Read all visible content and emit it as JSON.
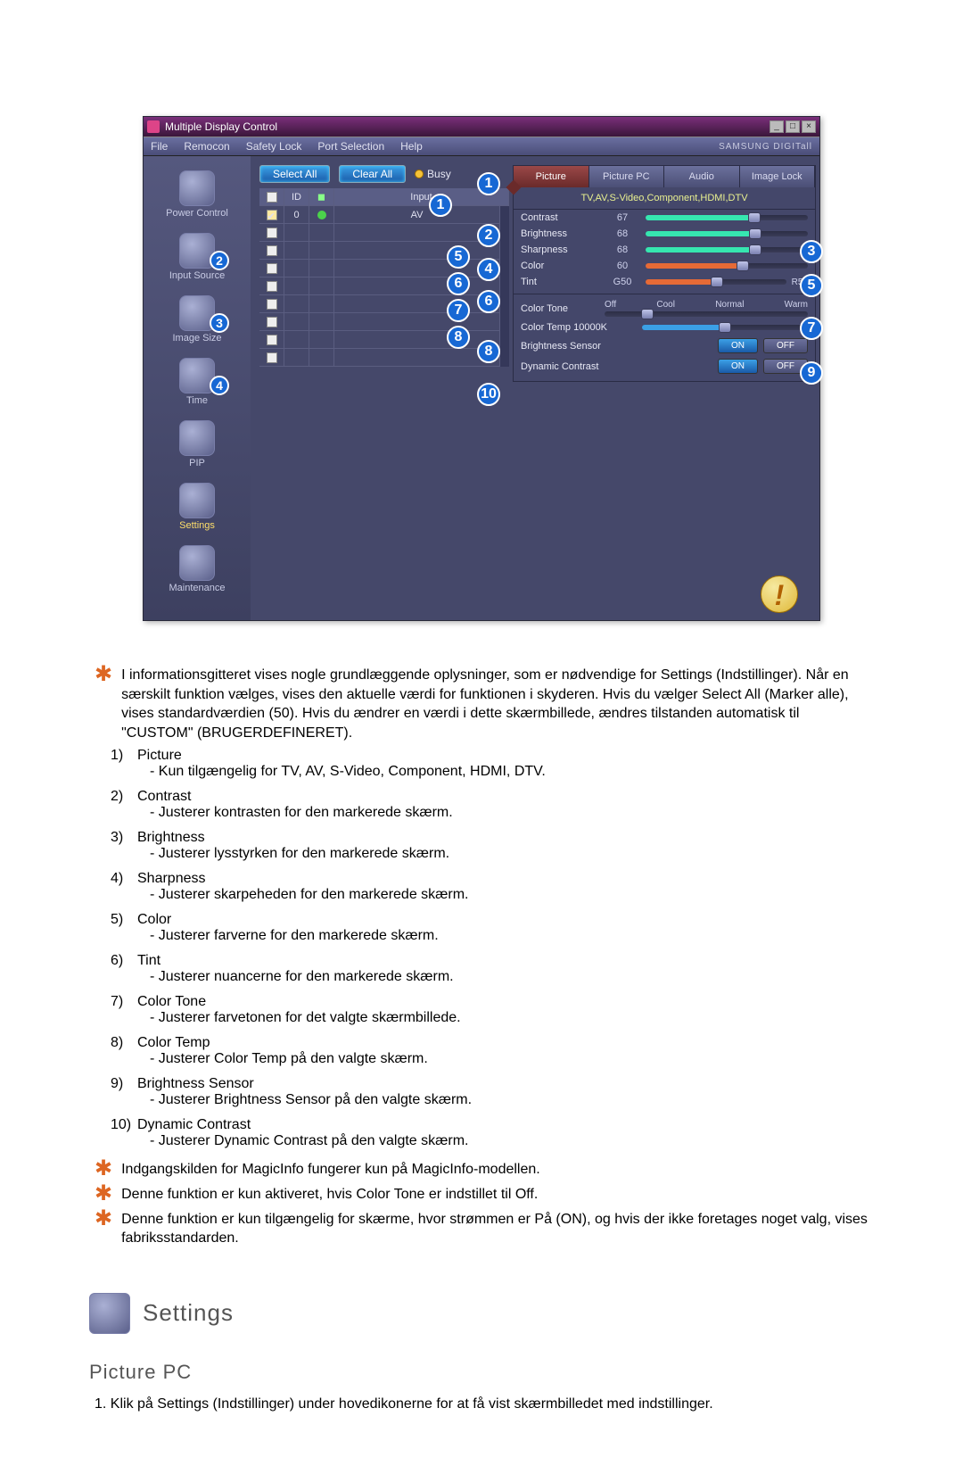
{
  "screenshot": {
    "window_title": "Multiple Display Control",
    "menus": [
      "File",
      "Remocon",
      "Safety Lock",
      "Port Selection",
      "Help"
    ],
    "brand": "SAMSUNG DIGITall",
    "toolbar": {
      "select_all": "Select All",
      "clear_all": "Clear All",
      "busy": "Busy"
    },
    "grid": {
      "headers": {
        "id": "ID",
        "input": "Input"
      },
      "rows": [
        {
          "id": "0",
          "status": "#4bd24b",
          "input": "AV"
        },
        {
          "id": "",
          "status": "",
          "input": ""
        },
        {
          "id": "",
          "status": "",
          "input": ""
        },
        {
          "id": "",
          "status": "",
          "input": ""
        },
        {
          "id": "",
          "status": "",
          "input": ""
        },
        {
          "id": "",
          "status": "",
          "input": ""
        },
        {
          "id": "",
          "status": "",
          "input": ""
        },
        {
          "id": "",
          "status": "",
          "input": ""
        },
        {
          "id": "",
          "status": "",
          "input": ""
        },
        {
          "id": "",
          "status": "",
          "input": ""
        }
      ]
    },
    "sidebar": [
      {
        "label": "Power Control",
        "badge": ""
      },
      {
        "label": "Input Source",
        "badge": "2"
      },
      {
        "label": "Image Size",
        "badge": "3"
      },
      {
        "label": "Time",
        "badge": "4"
      },
      {
        "label": "PIP",
        "badge": ""
      },
      {
        "label": "Settings",
        "badge": "",
        "active": true
      },
      {
        "label": "Maintenance",
        "badge": ""
      }
    ],
    "panel": {
      "tabs": [
        "Picture",
        "Picture PC",
        "Audio",
        "Image Lock"
      ],
      "active_tab": 0,
      "subtitle": "TV,AV,S-Video,Component,HDMI,DTV",
      "rows": [
        {
          "label": "Contrast",
          "value": "67",
          "fill_color": "#36e6b0",
          "num": "2"
        },
        {
          "label": "Brightness",
          "value": "68",
          "fill_color": "#36e6b0",
          "num": "3"
        },
        {
          "label": "Sharpness",
          "value": "68",
          "fill_color": "#36e6b0",
          "num": "4"
        },
        {
          "label": "Color",
          "value": "60",
          "fill_color": "#e66a36",
          "num": "5"
        }
      ],
      "tint": {
        "label": "Tint",
        "left": "G50",
        "right": "R50",
        "num": "6"
      },
      "color_tone": {
        "label": "Color Tone",
        "options": [
          "Off",
          "Cool",
          "Normal",
          "Warm"
        ],
        "num": "7"
      },
      "color_temp": {
        "label": "Color Temp 10000K",
        "num": "8"
      },
      "brightness_sensor": {
        "label": "Brightness Sensor",
        "on": "ON",
        "off": "OFF",
        "num": "9"
      },
      "dynamic_contrast": {
        "label": "Dynamic Contrast",
        "on": "ON",
        "off": "OFF",
        "num": "10"
      }
    },
    "callouts": {
      "top": "1",
      "grid": [
        "5",
        "6",
        "7",
        "8"
      ]
    }
  },
  "notes": {
    "intro": "I informationsgitteret vises nogle grundlæggende oplysninger, som er nødvendige for Settings (Indstillinger). Når en særskilt funktion vælges, vises den aktuelle værdi for funktionen i skyderen. Hvis du vælger Select All (Marker alle), vises standardværdien (50). Hvis du ændrer en værdi i dette skærmbillede, ændres tilstanden automatisk til \"CUSTOM\" (BRUGERDEFINERET).",
    "items": [
      {
        "num": "1)",
        "title": "Picture",
        "sub": "- Kun tilgængelig for TV, AV, S-Video, Component, HDMI, DTV."
      },
      {
        "num": "2)",
        "title": "Contrast",
        "sub": "- Justerer kontrasten for den markerede skærm."
      },
      {
        "num": "3)",
        "title": "Brightness",
        "sub": "- Justerer lysstyrken for den markerede skærm."
      },
      {
        "num": "4)",
        "title": "Sharpness",
        "sub": "- Justerer skarpeheden for den markerede skærm."
      },
      {
        "num": "5)",
        "title": "Color",
        "sub": "- Justerer farverne for den markerede skærm."
      },
      {
        "num": "6)",
        "title": "Tint",
        "sub": "- Justerer nuancerne for den markerede skærm."
      },
      {
        "num": "7)",
        "title": "Color Tone",
        "sub": "- Justerer farvetonen for det valgte skærmbillede."
      },
      {
        "num": "8)",
        "title": "Color Temp",
        "sub": "- Justerer Color Temp på den valgte skærm."
      },
      {
        "num": "9)",
        "title": "Brightness Sensor",
        "sub": "- Justerer Brightness Sensor på den valgte skærm."
      },
      {
        "num": "10)",
        "title": "Dynamic Contrast",
        "sub": "- Justerer Dynamic Contrast på den valgte skærm."
      }
    ],
    "footnotes": [
      "Indgangskilden for MagicInfo fungerer kun på MagicInfo-modellen.",
      "Denne funktion er kun aktiveret, hvis Color Tone er indstillet til Off.",
      "Denne funktion er kun tilgængelig for skærme, hvor strømmen er På (ON), og hvis der ikke foretages noget valg, vises fabriksstandarden."
    ]
  },
  "section": {
    "heading": "Settings",
    "subheading": "Picture PC",
    "step1": "1. Klik på Settings (Indstillinger) under hovedikonerne for at få vist skærmbilledet med indstillinger."
  }
}
